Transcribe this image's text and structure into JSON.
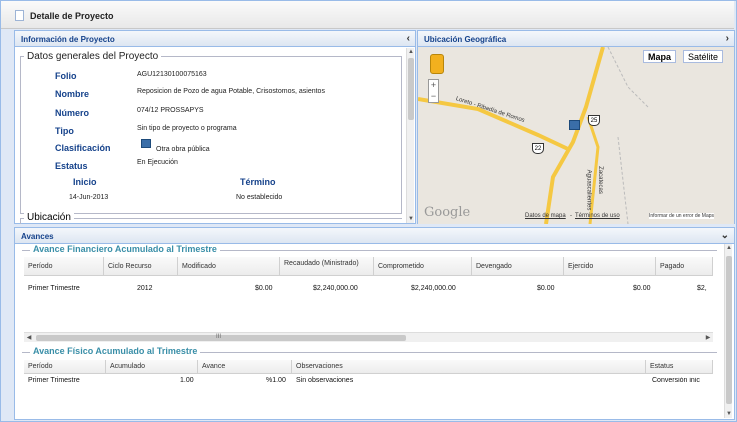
{
  "window": {
    "title": "Detalle de Proyecto"
  },
  "info_panel": {
    "title": "Información de Proyecto",
    "collapse_icon": "chevron-left-icon",
    "fieldset_title": "Datos generales del Proyecto",
    "fields": [
      {
        "label": "Folio",
        "value": "AGU12130100075163"
      },
      {
        "label": "Nombre",
        "value": "Reposicion de Pozo de agua Potable, Crisostomos, asientos"
      },
      {
        "label": "Número",
        "value": "074/12 PROSSAPYS"
      },
      {
        "label": "Tipo",
        "value": "Sin tipo de proyecto o programa"
      },
      {
        "label": "Clasificación",
        "value": "Otra obra pública"
      },
      {
        "label": "Estatus",
        "value": "En Ejecución"
      }
    ],
    "inicio_label": "Inicio",
    "termino_label": "Término",
    "inicio_value": "14-Jun-2013",
    "termino_value": "No establecido",
    "ubicacion_title": "Ubicación"
  },
  "geo_panel": {
    "title": "Ubicación Geográfica",
    "expand_icon": "chevron-right-icon",
    "map_btn": "Mapa",
    "sat_btn": "Satélite",
    "road_label": "Loreto - Ribadía de Romos",
    "shield_a": "22",
    "shield_b": "25",
    "place_a": "Zacatecas",
    "place_b": "Aguascalientes",
    "google": "Google",
    "map_data": "Datos de mapa",
    "terms": "Términos de uso",
    "report": "Informar de un error de Maps",
    "sep": "-"
  },
  "avances": {
    "title": "Avances",
    "toggle_icon": "chevron-down-icon",
    "financiero": {
      "title": "Avance Financiero Acumulado al Trimestre",
      "columns": [
        "Período",
        "Ciclo Recurso",
        "Modificado",
        "Recaudado (Ministrado)",
        "Comprometido",
        "Devengado",
        "Ejercido",
        "Pagado"
      ],
      "row": [
        "Primer Trimestre",
        "2012",
        "$0.00",
        "$2,240,000.00",
        "$2,240,000.00",
        "$0.00",
        "$0.00",
        "$2,"
      ],
      "scroll_mark": "III"
    },
    "fisico": {
      "title": "Avance Físico Acumulado al Trimestre",
      "columns": [
        "Período",
        "Acumulado",
        "Avance",
        "Observaciones",
        "Estatus"
      ],
      "row": [
        "Primer Trimestre",
        "1.00",
        "%1.00",
        "Sin observaciones",
        "Conversión inic"
      ]
    }
  },
  "colors": {
    "header_text": "#15428b",
    "section_title": "#3a8fa8",
    "road": "#f5c842",
    "map_bg": "#eae6df"
  }
}
